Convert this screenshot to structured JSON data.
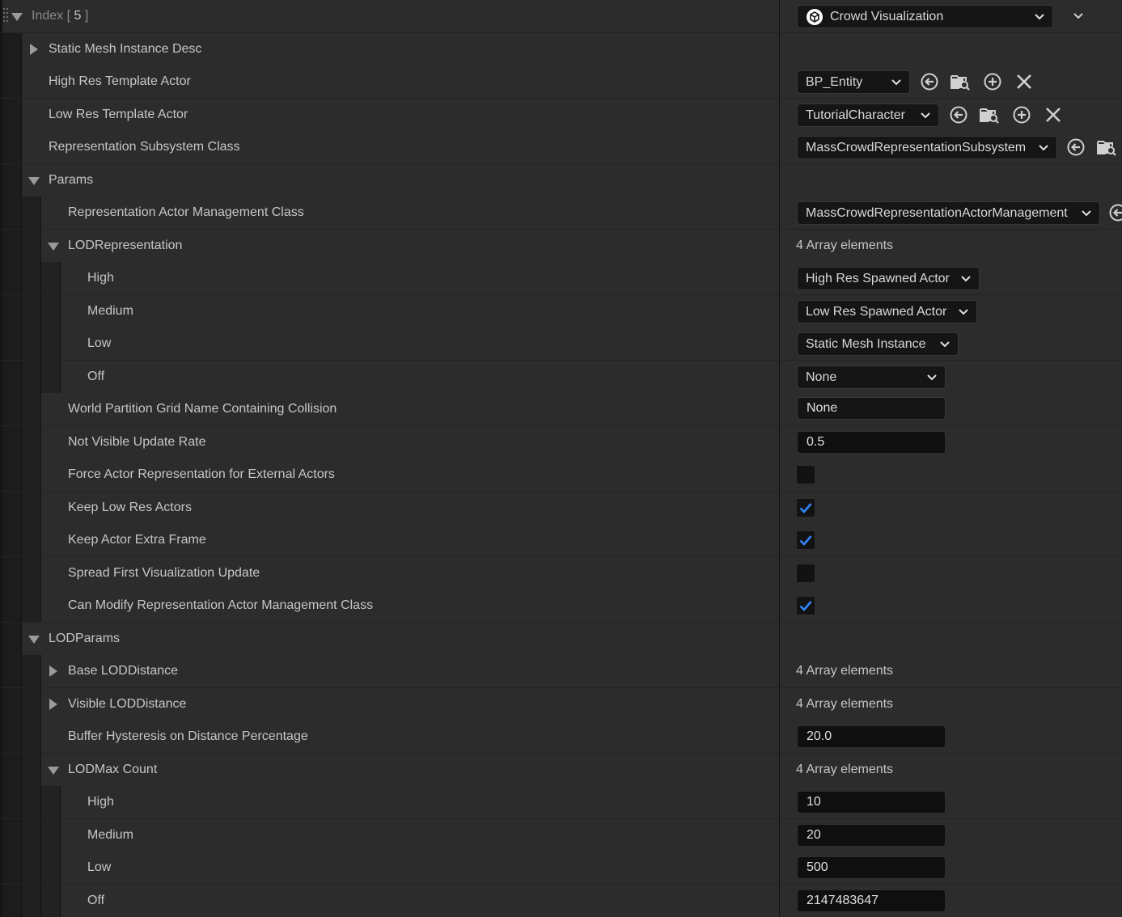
{
  "header": {
    "index_label": "Index [ ",
    "index_value": "5",
    "index_close": " ]",
    "component_dropdown": "Crowd Visualization"
  },
  "rows": {
    "static_mesh": "Static Mesh Instance Desc",
    "high_res_template": {
      "label": "High Res Template Actor",
      "value": "BP_Entity"
    },
    "low_res_template": {
      "label": "Low Res Template Actor",
      "value": "TutorialCharacter"
    },
    "rep_subsystem": {
      "label": "Representation Subsystem Class",
      "value": "MassCrowdRepresentationSubsystem"
    },
    "params": "Params",
    "rep_actor_mgmt": {
      "label": "Representation Actor Management Class",
      "value": "MassCrowdRepresentationActorManagement"
    },
    "lod_representation": {
      "label": "LODRepresentation",
      "value": "4 Array elements"
    },
    "lod_rep_high": {
      "label": "High",
      "value": "High Res Spawned Actor"
    },
    "lod_rep_medium": {
      "label": "Medium",
      "value": "Low Res Spawned Actor"
    },
    "lod_rep_low": {
      "label": "Low",
      "value": "Static Mesh Instance"
    },
    "lod_rep_off": {
      "label": "Off",
      "value": "None"
    },
    "world_partition": {
      "label": "World Partition Grid Name Containing Collision",
      "value": "None"
    },
    "not_visible_rate": {
      "label": "Not Visible Update Rate",
      "value": "0.5"
    },
    "force_actor_rep": {
      "label": "Force Actor Representation for External Actors",
      "checked": false
    },
    "keep_low_res": {
      "label": "Keep Low Res Actors",
      "checked": true
    },
    "keep_extra_frame": {
      "label": "Keep Actor Extra Frame",
      "checked": true
    },
    "spread_first": {
      "label": "Spread First Visualization Update",
      "checked": false
    },
    "can_modify": {
      "label": "Can Modify Representation Actor Management Class",
      "checked": true
    },
    "lod_params": "LODParams",
    "base_lod_distance": {
      "label": "Base LODDistance",
      "value": "4 Array elements"
    },
    "visible_lod_distance": {
      "label": "Visible LODDistance",
      "value": "4 Array elements"
    },
    "buffer_hysteresis": {
      "label": "Buffer Hysteresis on Distance Percentage",
      "value": "20.0"
    },
    "lod_max_count": {
      "label": "LODMax Count",
      "value": "4 Array elements"
    },
    "max_high": {
      "label": "High",
      "value": "10"
    },
    "max_medium": {
      "label": "Medium",
      "value": "20"
    },
    "max_low": {
      "label": "Low",
      "value": "500"
    },
    "max_off": {
      "label": "Off",
      "value": "2147483647"
    }
  },
  "icons": [
    "grip-icon",
    "collapse-arrow-icon",
    "blueprint-icon",
    "chevron-down-icon",
    "use-selected-icon",
    "browse-icon",
    "add-icon",
    "clear-icon"
  ],
  "colors": {
    "accent": "#2f86ff",
    "background": "#242424",
    "row": "#2c2c2c"
  }
}
